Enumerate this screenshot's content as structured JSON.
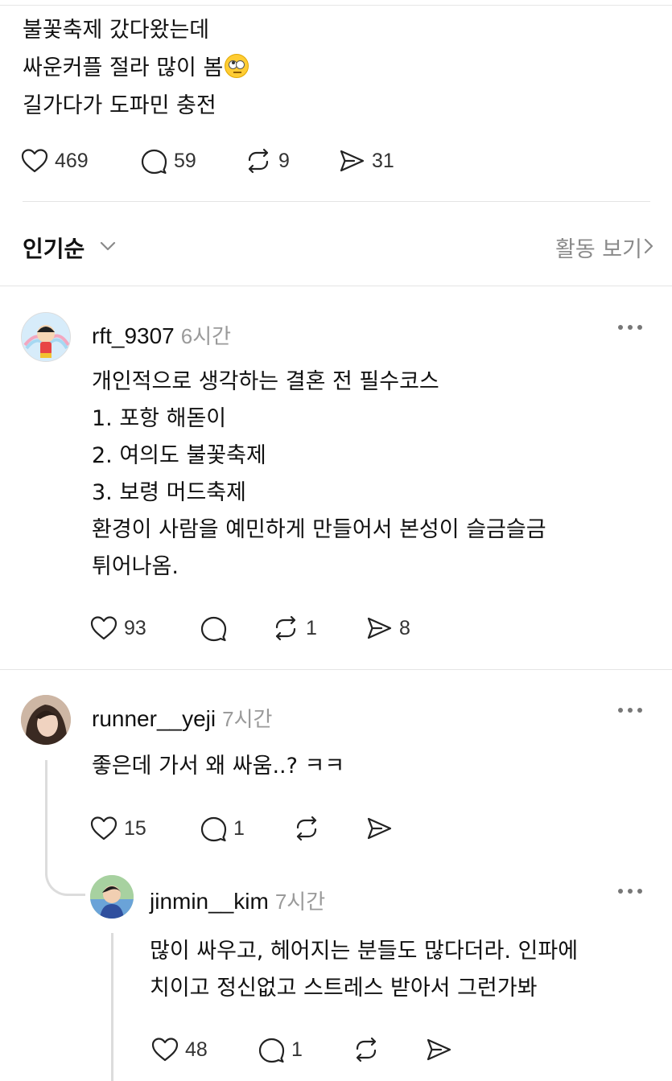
{
  "post": {
    "lines": [
      "불꽃축제 갔다왔는데",
      "싸운커플 절라 많이 봄",
      "길가다가 도파민 충전"
    ],
    "emoji": "face-with-rolling-eyes",
    "likes": "469",
    "comments": "59",
    "reposts": "9",
    "shares": "31"
  },
  "sort": {
    "label": "인기순",
    "activity_label": "활동 보기"
  },
  "comments": [
    {
      "username": "rft_9307",
      "time": "6시간",
      "lines": [
        "개인적으로 생각하는 결혼 전 필수코스",
        "1. 포항 해돋이",
        "2. 여의도 불꽃축제",
        "3. 보령 머드축제",
        "환경이 사람을 예민하게 만들어서 본성이 슬금슬금",
        "튀어나옴."
      ],
      "likes": "93",
      "comments": "",
      "reposts": "1",
      "shares": "8"
    },
    {
      "username": "runner__yeji",
      "time": "7시간",
      "lines": [
        "좋은데 가서 왜 싸움..? ㅋㅋ"
      ],
      "likes": "15",
      "comments": "1",
      "reposts": "",
      "shares": ""
    },
    {
      "username": "jinmin__kim",
      "time": "7시간",
      "lines": [
        "많이 싸우고, 헤어지는 분들도 많다더라. 인파에",
        "치이고 정신없고 스트레스 받아서 그런가봐"
      ],
      "likes": "48",
      "comments": "1",
      "reposts": "",
      "shares": ""
    }
  ]
}
